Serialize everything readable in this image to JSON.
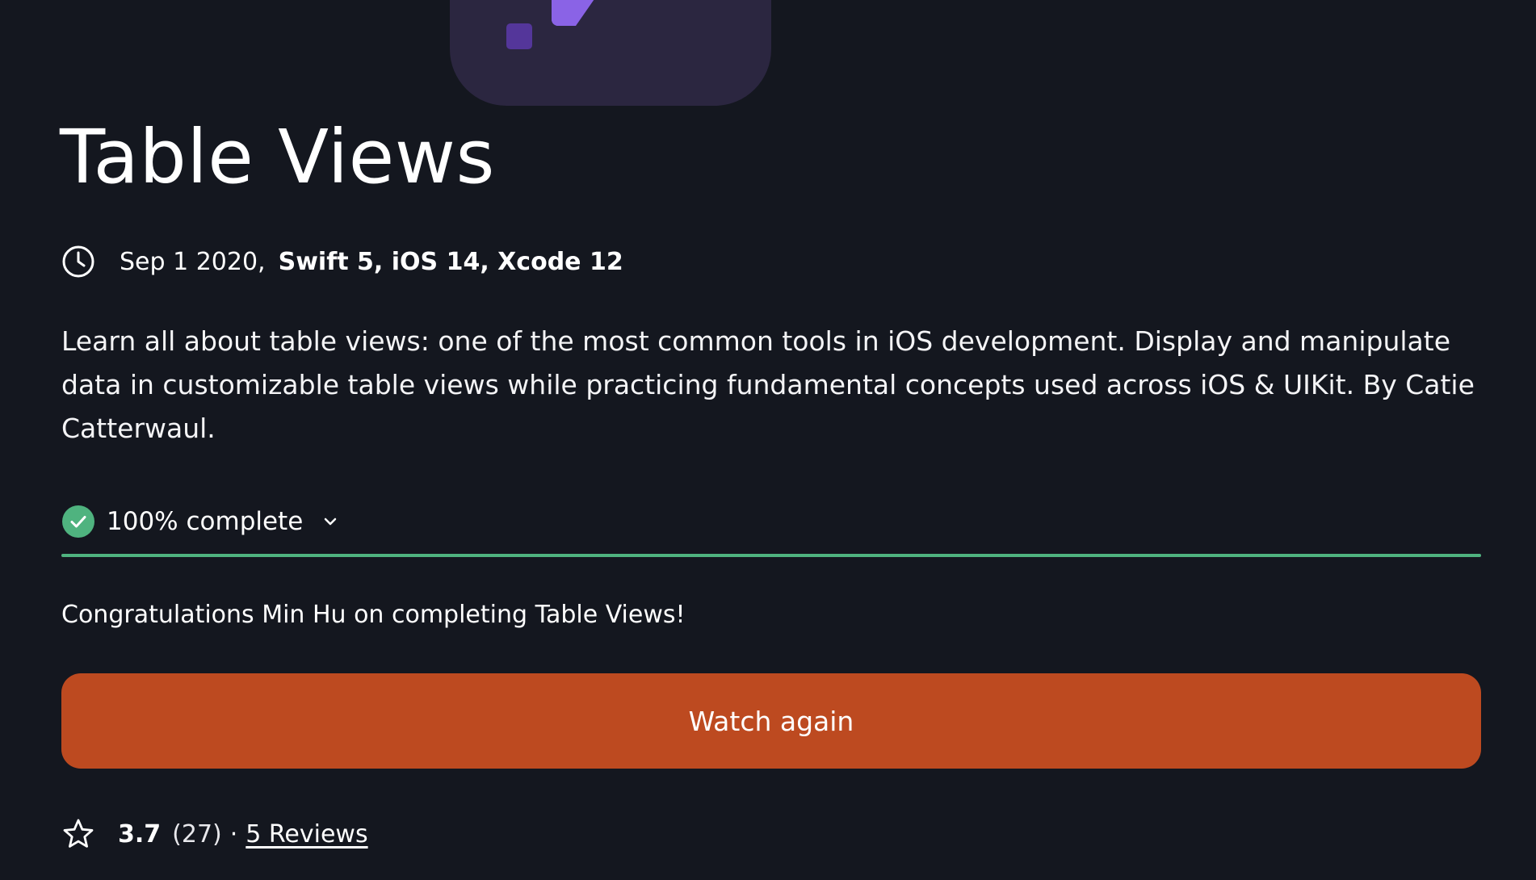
{
  "course": {
    "title": "Table Views",
    "date": "Sep 1 2020,",
    "technologies": "Swift 5, iOS 14, Xcode 12",
    "description": "Learn all about table views: one of the most common tools in iOS development. Display and manipulate data in customizable table views while practicing fundamental concepts used across iOS & UIKit. By Catie Catterwaul."
  },
  "progress": {
    "label": "100% complete",
    "fraction": 1.0,
    "color": "#4fb37f",
    "icons": [
      "check-circle-icon",
      "chevron-down-icon"
    ]
  },
  "completion": {
    "message": "Congratulations Min Hu on completing Table Views!"
  },
  "actions": {
    "watch_again_label": "Watch again",
    "accent_color": "#bd4a20"
  },
  "rating": {
    "score": "3.7",
    "count": "(27)",
    "separator": "·",
    "reviews_link": "5 Reviews",
    "icon": "star-outline-icon"
  },
  "icons": {
    "meta": "clock-icon"
  }
}
